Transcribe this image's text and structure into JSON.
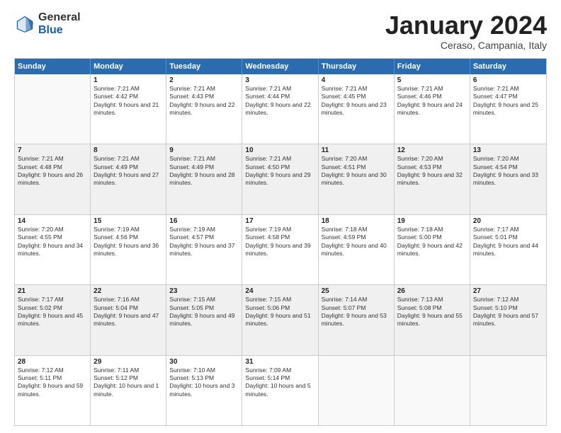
{
  "logo": {
    "general": "General",
    "blue": "Blue"
  },
  "title": "January 2024",
  "location": "Ceraso, Campania, Italy",
  "header_days": [
    "Sunday",
    "Monday",
    "Tuesday",
    "Wednesday",
    "Thursday",
    "Friday",
    "Saturday"
  ],
  "rows": [
    [
      {
        "day": "",
        "sunrise": "",
        "sunset": "",
        "daylight": "",
        "empty": true
      },
      {
        "day": "1",
        "sunrise": "Sunrise: 7:21 AM",
        "sunset": "Sunset: 4:42 PM",
        "daylight": "Daylight: 9 hours and 21 minutes."
      },
      {
        "day": "2",
        "sunrise": "Sunrise: 7:21 AM",
        "sunset": "Sunset: 4:43 PM",
        "daylight": "Daylight: 9 hours and 22 minutes."
      },
      {
        "day": "3",
        "sunrise": "Sunrise: 7:21 AM",
        "sunset": "Sunset: 4:44 PM",
        "daylight": "Daylight: 9 hours and 22 minutes."
      },
      {
        "day": "4",
        "sunrise": "Sunrise: 7:21 AM",
        "sunset": "Sunset: 4:45 PM",
        "daylight": "Daylight: 9 hours and 23 minutes."
      },
      {
        "day": "5",
        "sunrise": "Sunrise: 7:21 AM",
        "sunset": "Sunset: 4:46 PM",
        "daylight": "Daylight: 9 hours and 24 minutes."
      },
      {
        "day": "6",
        "sunrise": "Sunrise: 7:21 AM",
        "sunset": "Sunset: 4:47 PM",
        "daylight": "Daylight: 9 hours and 25 minutes."
      }
    ],
    [
      {
        "day": "7",
        "sunrise": "Sunrise: 7:21 AM",
        "sunset": "Sunset: 4:48 PM",
        "daylight": "Daylight: 9 hours and 26 minutes."
      },
      {
        "day": "8",
        "sunrise": "Sunrise: 7:21 AM",
        "sunset": "Sunset: 4:49 PM",
        "daylight": "Daylight: 9 hours and 27 minutes."
      },
      {
        "day": "9",
        "sunrise": "Sunrise: 7:21 AM",
        "sunset": "Sunset: 4:49 PM",
        "daylight": "Daylight: 9 hours and 28 minutes."
      },
      {
        "day": "10",
        "sunrise": "Sunrise: 7:21 AM",
        "sunset": "Sunset: 4:50 PM",
        "daylight": "Daylight: 9 hours and 29 minutes."
      },
      {
        "day": "11",
        "sunrise": "Sunrise: 7:20 AM",
        "sunset": "Sunset: 4:51 PM",
        "daylight": "Daylight: 9 hours and 30 minutes."
      },
      {
        "day": "12",
        "sunrise": "Sunrise: 7:20 AM",
        "sunset": "Sunset: 4:53 PM",
        "daylight": "Daylight: 9 hours and 32 minutes."
      },
      {
        "day": "13",
        "sunrise": "Sunrise: 7:20 AM",
        "sunset": "Sunset: 4:54 PM",
        "daylight": "Daylight: 9 hours and 33 minutes."
      }
    ],
    [
      {
        "day": "14",
        "sunrise": "Sunrise: 7:20 AM",
        "sunset": "Sunset: 4:55 PM",
        "daylight": "Daylight: 9 hours and 34 minutes."
      },
      {
        "day": "15",
        "sunrise": "Sunrise: 7:19 AM",
        "sunset": "Sunset: 4:56 PM",
        "daylight": "Daylight: 9 hours and 36 minutes."
      },
      {
        "day": "16",
        "sunrise": "Sunrise: 7:19 AM",
        "sunset": "Sunset: 4:57 PM",
        "daylight": "Daylight: 9 hours and 37 minutes."
      },
      {
        "day": "17",
        "sunrise": "Sunrise: 7:19 AM",
        "sunset": "Sunset: 4:58 PM",
        "daylight": "Daylight: 9 hours and 39 minutes."
      },
      {
        "day": "18",
        "sunrise": "Sunrise: 7:18 AM",
        "sunset": "Sunset: 4:59 PM",
        "daylight": "Daylight: 9 hours and 40 minutes."
      },
      {
        "day": "19",
        "sunrise": "Sunrise: 7:18 AM",
        "sunset": "Sunset: 5:00 PM",
        "daylight": "Daylight: 9 hours and 42 minutes."
      },
      {
        "day": "20",
        "sunrise": "Sunrise: 7:17 AM",
        "sunset": "Sunset: 5:01 PM",
        "daylight": "Daylight: 9 hours and 44 minutes."
      }
    ],
    [
      {
        "day": "21",
        "sunrise": "Sunrise: 7:17 AM",
        "sunset": "Sunset: 5:02 PM",
        "daylight": "Daylight: 9 hours and 45 minutes."
      },
      {
        "day": "22",
        "sunrise": "Sunrise: 7:16 AM",
        "sunset": "Sunset: 5:04 PM",
        "daylight": "Daylight: 9 hours and 47 minutes."
      },
      {
        "day": "23",
        "sunrise": "Sunrise: 7:15 AM",
        "sunset": "Sunset: 5:05 PM",
        "daylight": "Daylight: 9 hours and 49 minutes."
      },
      {
        "day": "24",
        "sunrise": "Sunrise: 7:15 AM",
        "sunset": "Sunset: 5:06 PM",
        "daylight": "Daylight: 9 hours and 51 minutes."
      },
      {
        "day": "25",
        "sunrise": "Sunrise: 7:14 AM",
        "sunset": "Sunset: 5:07 PM",
        "daylight": "Daylight: 9 hours and 53 minutes."
      },
      {
        "day": "26",
        "sunrise": "Sunrise: 7:13 AM",
        "sunset": "Sunset: 5:08 PM",
        "daylight": "Daylight: 9 hours and 55 minutes."
      },
      {
        "day": "27",
        "sunrise": "Sunrise: 7:12 AM",
        "sunset": "Sunset: 5:10 PM",
        "daylight": "Daylight: 9 hours and 57 minutes."
      }
    ],
    [
      {
        "day": "28",
        "sunrise": "Sunrise: 7:12 AM",
        "sunset": "Sunset: 5:11 PM",
        "daylight": "Daylight: 9 hours and 59 minutes."
      },
      {
        "day": "29",
        "sunrise": "Sunrise: 7:11 AM",
        "sunset": "Sunset: 5:12 PM",
        "daylight": "Daylight: 10 hours and 1 minute."
      },
      {
        "day": "30",
        "sunrise": "Sunrise: 7:10 AM",
        "sunset": "Sunset: 5:13 PM",
        "daylight": "Daylight: 10 hours and 3 minutes."
      },
      {
        "day": "31",
        "sunrise": "Sunrise: 7:09 AM",
        "sunset": "Sunset: 5:14 PM",
        "daylight": "Daylight: 10 hours and 5 minutes."
      },
      {
        "day": "",
        "sunrise": "",
        "sunset": "",
        "daylight": "",
        "empty": true
      },
      {
        "day": "",
        "sunrise": "",
        "sunset": "",
        "daylight": "",
        "empty": true
      },
      {
        "day": "",
        "sunrise": "",
        "sunset": "",
        "daylight": "",
        "empty": true
      }
    ]
  ]
}
